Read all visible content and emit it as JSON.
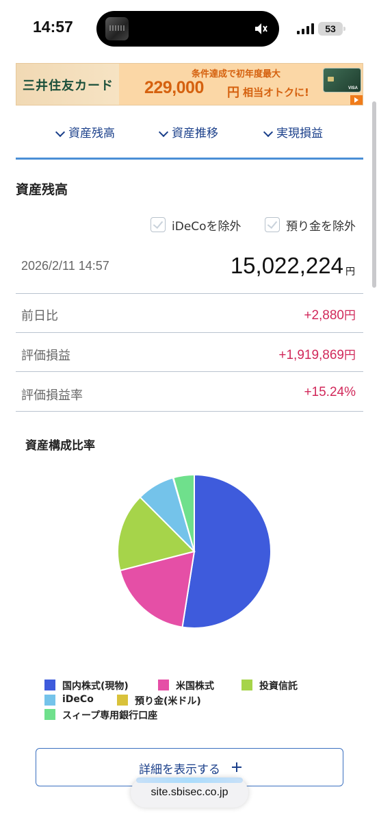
{
  "status_bar": {
    "time": "14:57",
    "battery": "53"
  },
  "ad_banner": {
    "brand": "三井住友カード",
    "line1": "条件達成で初年度最大",
    "amount": "229,000",
    "amount_unit": "円",
    "suffix": "相当オトクに!",
    "card_brand": "VISA"
  },
  "tabs": [
    {
      "label": "資産残高"
    },
    {
      "label": "資産推移"
    },
    {
      "label": "実現損益"
    }
  ],
  "section_title": "資産残高",
  "filters": [
    {
      "label": "iDeCoを除外",
      "checked": false
    },
    {
      "label": "預り金を除外",
      "checked": false
    }
  ],
  "balance": {
    "datetime": "2026/2/11 14:57",
    "total": "15,022,224",
    "unit": "円"
  },
  "metrics": [
    {
      "label": "前日比",
      "value": "+2,880",
      "unit": "円"
    },
    {
      "label": "評価損益",
      "value": "+1,919,869",
      "unit": "円"
    },
    {
      "label": "評価損益率",
      "value": "+15.24%",
      "unit": ""
    }
  ],
  "chart_title": "資産構成比率",
  "chart_data": {
    "type": "pie",
    "title": "資産構成比率",
    "legend_position": "bottom",
    "slices": [
      {
        "label": "国内株式(現物)",
        "value": 52.5,
        "color": "#3e5bdc"
      },
      {
        "label": "米国株式",
        "value": 18.5,
        "color": "#e54fa6"
      },
      {
        "label": "投資信託",
        "value": 16.5,
        "color": "#a6d44a"
      },
      {
        "label": "iDeCo",
        "value": 8.0,
        "color": "#74c3ea"
      },
      {
        "label": "預り金(米ドル)",
        "value": 0.1,
        "color": "#d9c23b"
      },
      {
        "label": "スィープ専用銀行口座",
        "value": 4.4,
        "color": "#6fe08c"
      }
    ]
  },
  "detail_button": {
    "label": "詳細を表示する"
  },
  "url_bar": {
    "url": "site.sbisec.co.jp"
  },
  "colors": {
    "accent": "#1a3f8a",
    "positive": "#d1285a",
    "tab_underline": "#4a8fd6"
  }
}
